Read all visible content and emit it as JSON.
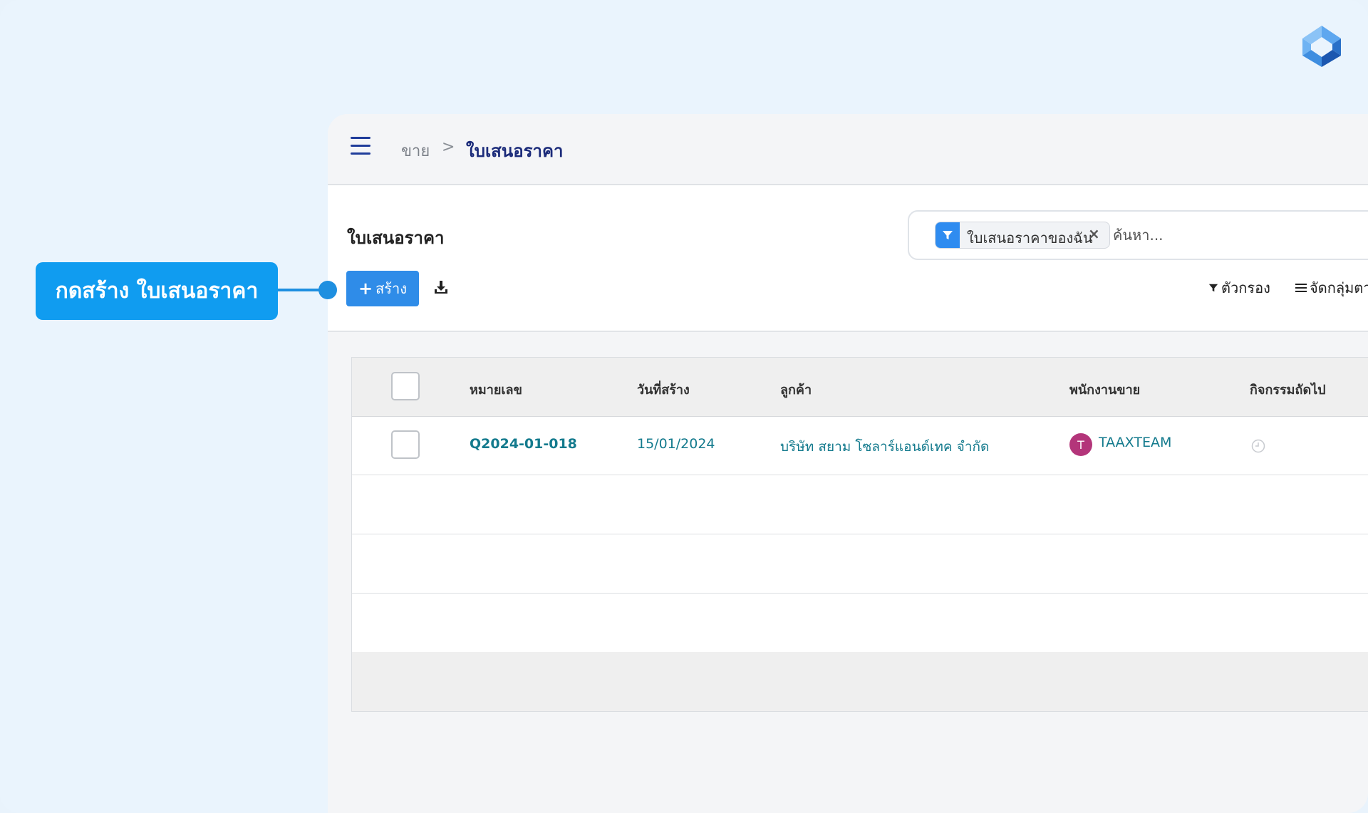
{
  "breadcrumb": {
    "parent": "ขาย",
    "separator": ">",
    "current": "ใบเสนอราคา"
  },
  "page": {
    "title": "ใบเสนอราคา"
  },
  "search": {
    "facet_label": "ใบเสนอราคาของฉัน",
    "facet_remove": "×",
    "placeholder": "ค้นหา..."
  },
  "toolbar": {
    "create_plus": "+",
    "create_label": "สร้าง",
    "filter_label": "ตัวกรอง",
    "group_label": "จัดกลุ่มตา"
  },
  "table": {
    "headers": [
      "หมายเลข",
      "วันที่สร้าง",
      "ลูกค้า",
      "พนักงานขาย",
      "กิจกรรมถัดไป"
    ],
    "rows": [
      {
        "number": "Q2024-01-018",
        "date": "15/01/2024",
        "customer": "บริษัท สยาม โซลาร์แอนด์เทค จำกัด",
        "salesperson_initial": "T",
        "salesperson": "TAAXTEAM"
      }
    ]
  },
  "callout": {
    "text": "กดสร้าง ใบเสนอราคา"
  },
  "colors": {
    "primary": "#2f8ce8",
    "callout": "#109cf0",
    "link": "#137a8d",
    "breadcrumb_current": "#1b2b7a",
    "avatar": "#b3357a"
  },
  "icons": {
    "menu": "hamburger-icon",
    "facet": "filter-icon",
    "download": "download-icon",
    "activity": "clock-icon",
    "brand": "logo-icon"
  }
}
